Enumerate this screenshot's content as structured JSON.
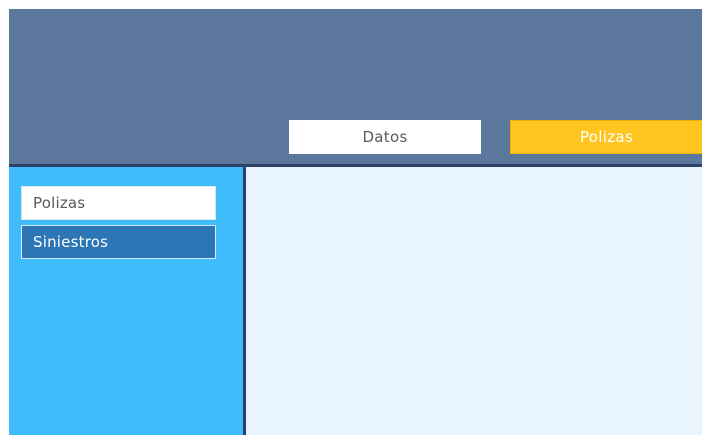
{
  "header": {
    "tabs": [
      {
        "label": "Datos",
        "state": "inactive"
      },
      {
        "label": "Polizas",
        "state": "active"
      }
    ]
  },
  "sidebar": {
    "items": [
      {
        "label": "Polizas",
        "state": "normal"
      },
      {
        "label": "Siniestros",
        "state": "selected"
      }
    ]
  },
  "colors": {
    "header_bg": "#5c779c",
    "divider": "#2e4266",
    "active_tab": "#ffc520",
    "sidebar_bg": "#3fbcfb",
    "selected_item": "#2c76b6",
    "content_bg": "#e8f5fe"
  }
}
